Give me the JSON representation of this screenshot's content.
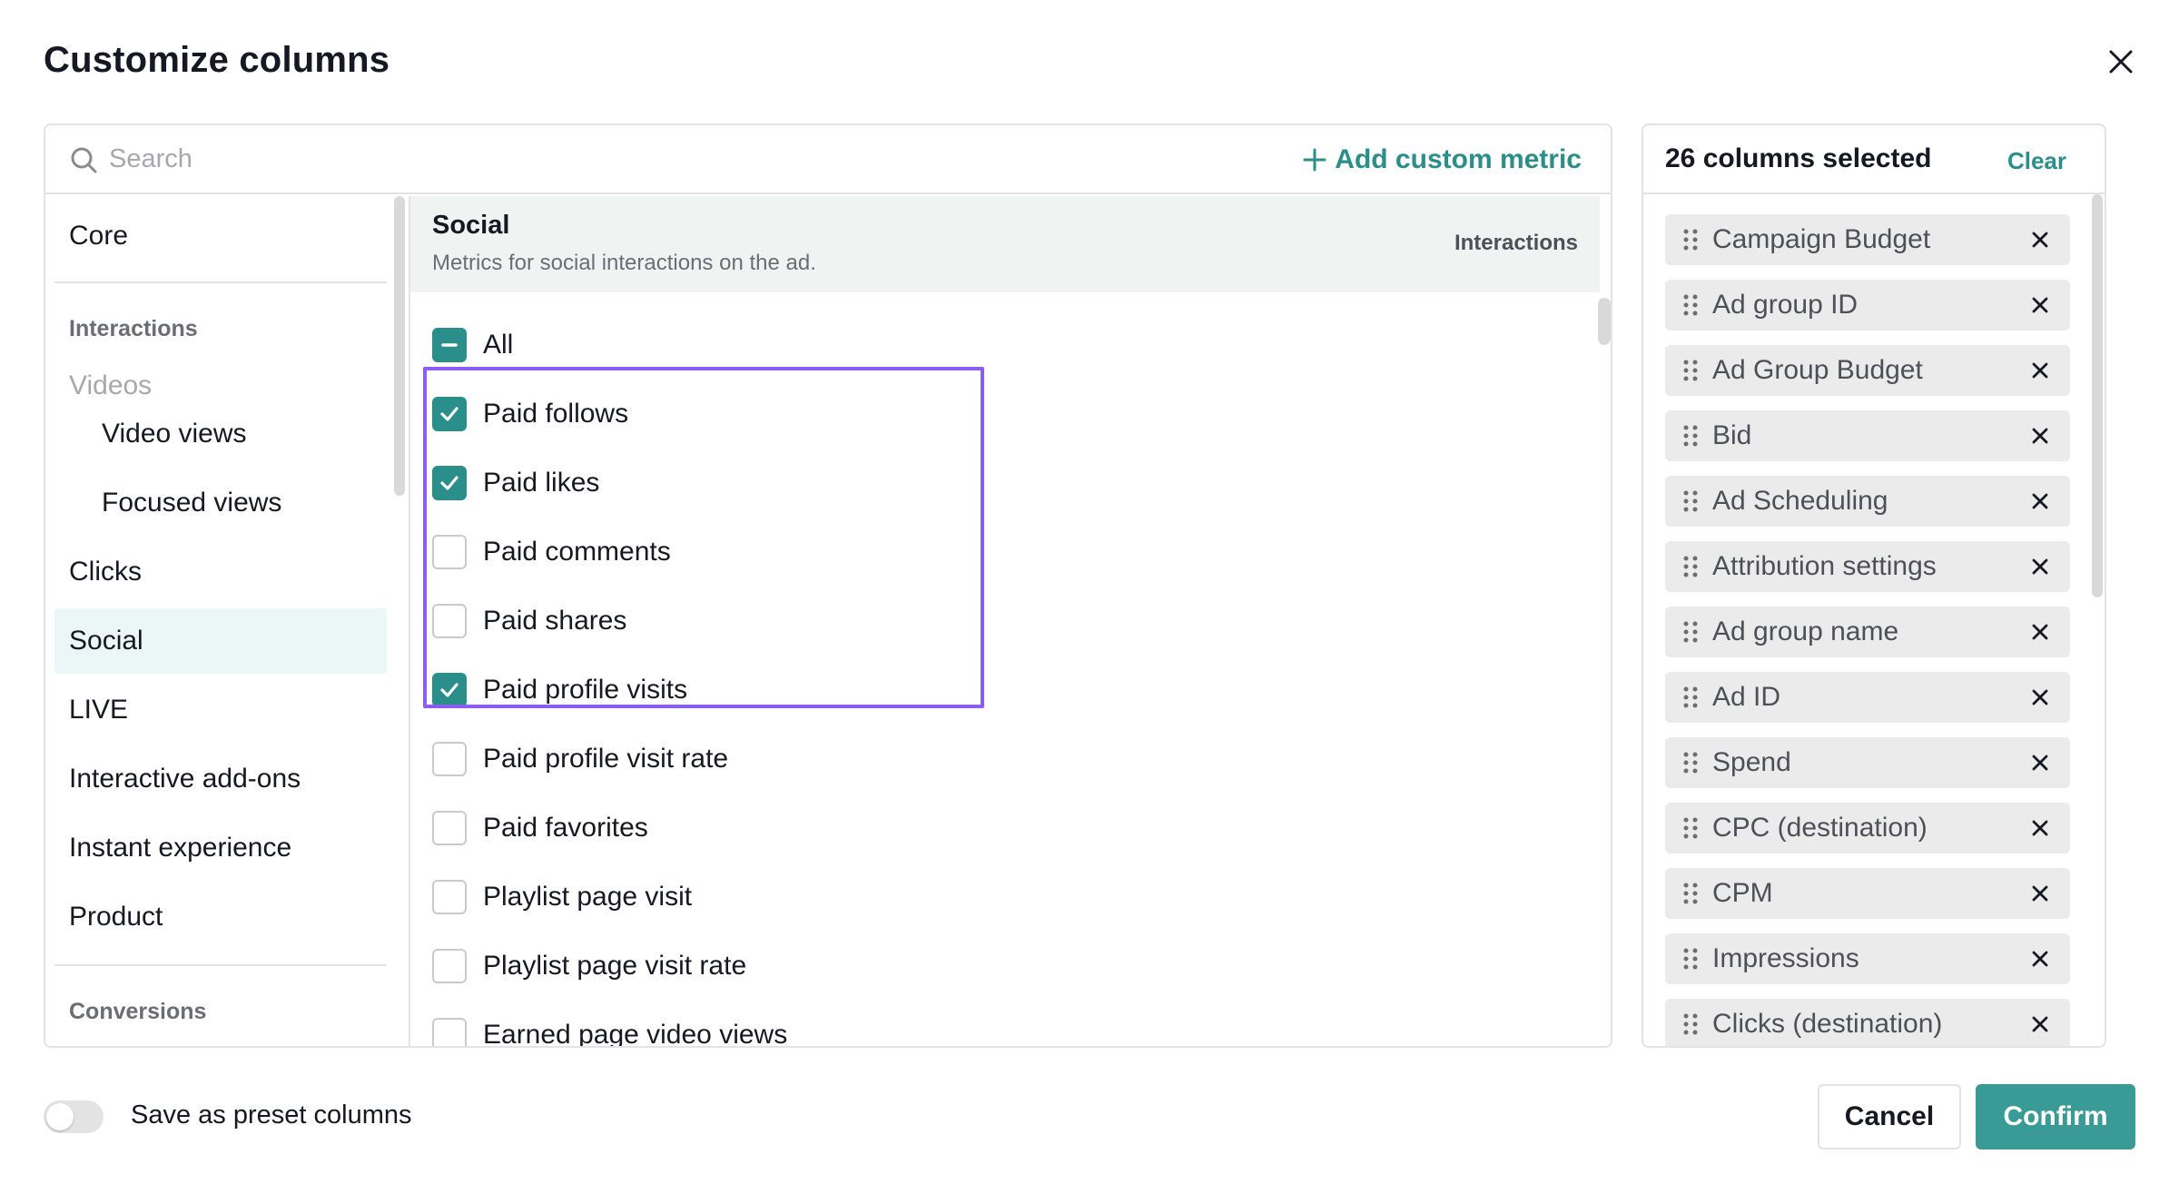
{
  "dialog": {
    "title": "Customize columns"
  },
  "search": {
    "placeholder": "Search",
    "value": ""
  },
  "add_custom_metric": "Add custom metric",
  "categories": [
    {
      "label": "Core",
      "kind": "item"
    },
    {
      "label": "Interactions",
      "kind": "heading"
    },
    {
      "label": "Videos",
      "kind": "subheading"
    },
    {
      "label": "Video views",
      "kind": "subitem"
    },
    {
      "label": "Focused views",
      "kind": "subitem"
    },
    {
      "label": "Clicks",
      "kind": "item"
    },
    {
      "label": "Social",
      "kind": "item",
      "active": true
    },
    {
      "label": "LIVE",
      "kind": "item"
    },
    {
      "label": "Interactive add-ons",
      "kind": "item"
    },
    {
      "label": "Instant experience",
      "kind": "item"
    },
    {
      "label": "Product",
      "kind": "item"
    },
    {
      "label": "Conversions",
      "kind": "heading"
    }
  ],
  "section": {
    "title": "Social",
    "description": "Metrics for social interactions on the ad.",
    "tag": "Interactions"
  },
  "metrics": [
    {
      "label": "All",
      "state": "partial"
    },
    {
      "label": "Paid follows",
      "state": "checked"
    },
    {
      "label": "Paid likes",
      "state": "checked"
    },
    {
      "label": "Paid comments",
      "state": "unchecked"
    },
    {
      "label": "Paid shares",
      "state": "unchecked"
    },
    {
      "label": "Paid profile visits",
      "state": "checked"
    },
    {
      "label": "Paid profile visit rate",
      "state": "unchecked"
    },
    {
      "label": "Paid favorites",
      "state": "unchecked"
    },
    {
      "label": "Playlist page visit",
      "state": "unchecked"
    },
    {
      "label": "Playlist page visit rate",
      "state": "unchecked"
    },
    {
      "label": "Earned page video views",
      "state": "unchecked"
    }
  ],
  "selected": {
    "count_label": "26 columns selected",
    "clear_label": "Clear",
    "columns": [
      "Campaign Budget",
      "Ad group ID",
      "Ad Group Budget",
      "Bid",
      "Ad Scheduling",
      "Attribution settings",
      "Ad group name",
      "Ad ID",
      "Spend",
      "CPC (destination)",
      "CPM",
      "Impressions",
      "Clicks (destination)"
    ]
  },
  "footer": {
    "preset_label": "Save as preset columns",
    "preset_enabled": false,
    "cancel_label": "Cancel",
    "confirm_label": "Confirm"
  },
  "colors": {
    "accent": "#2a8f8b",
    "confirm_bg": "#3a9b96",
    "highlight": "#8b5cf6",
    "active_category_bg": "#eaf7f6"
  },
  "icons": {
    "search": "search-icon",
    "close": "close-icon",
    "add": "plus-icon",
    "drag": "drag-handle-icon",
    "remove": "remove-icon",
    "check": "check-icon",
    "partial": "minus-icon"
  }
}
